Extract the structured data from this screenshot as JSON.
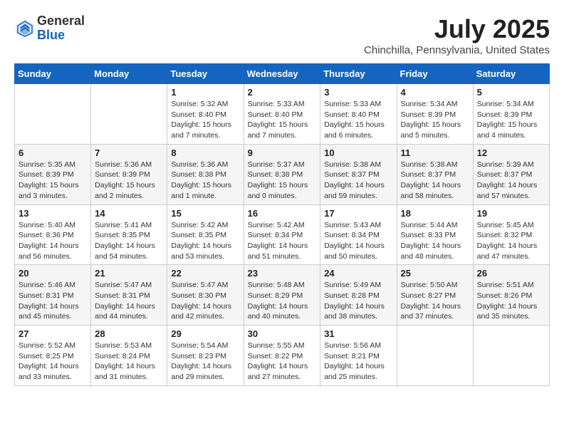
{
  "header": {
    "logo_general": "General",
    "logo_blue": "Blue",
    "month_title": "July 2025",
    "location": "Chinchilla, Pennsylvania, United States"
  },
  "weekdays": [
    "Sunday",
    "Monday",
    "Tuesday",
    "Wednesday",
    "Thursday",
    "Friday",
    "Saturday"
  ],
  "weeks": [
    [
      {
        "day": "",
        "info": ""
      },
      {
        "day": "",
        "info": ""
      },
      {
        "day": "1",
        "info": "Sunrise: 5:32 AM\nSunset: 8:40 PM\nDaylight: 15 hours and 7 minutes."
      },
      {
        "day": "2",
        "info": "Sunrise: 5:33 AM\nSunset: 8:40 PM\nDaylight: 15 hours and 7 minutes."
      },
      {
        "day": "3",
        "info": "Sunrise: 5:33 AM\nSunset: 8:40 PM\nDaylight: 15 hours and 6 minutes."
      },
      {
        "day": "4",
        "info": "Sunrise: 5:34 AM\nSunset: 8:39 PM\nDaylight: 15 hours and 5 minutes."
      },
      {
        "day": "5",
        "info": "Sunrise: 5:34 AM\nSunset: 8:39 PM\nDaylight: 15 hours and 4 minutes."
      }
    ],
    [
      {
        "day": "6",
        "info": "Sunrise: 5:35 AM\nSunset: 8:39 PM\nDaylight: 15 hours and 3 minutes."
      },
      {
        "day": "7",
        "info": "Sunrise: 5:36 AM\nSunset: 8:39 PM\nDaylight: 15 hours and 2 minutes."
      },
      {
        "day": "8",
        "info": "Sunrise: 5:36 AM\nSunset: 8:38 PM\nDaylight: 15 hours and 1 minute."
      },
      {
        "day": "9",
        "info": "Sunrise: 5:37 AM\nSunset: 8:38 PM\nDaylight: 15 hours and 0 minutes."
      },
      {
        "day": "10",
        "info": "Sunrise: 5:38 AM\nSunset: 8:37 PM\nDaylight: 14 hours and 59 minutes."
      },
      {
        "day": "11",
        "info": "Sunrise: 5:38 AM\nSunset: 8:37 PM\nDaylight: 14 hours and 58 minutes."
      },
      {
        "day": "12",
        "info": "Sunrise: 5:39 AM\nSunset: 8:37 PM\nDaylight: 14 hours and 57 minutes."
      }
    ],
    [
      {
        "day": "13",
        "info": "Sunrise: 5:40 AM\nSunset: 8:36 PM\nDaylight: 14 hours and 56 minutes."
      },
      {
        "day": "14",
        "info": "Sunrise: 5:41 AM\nSunset: 8:35 PM\nDaylight: 14 hours and 54 minutes."
      },
      {
        "day": "15",
        "info": "Sunrise: 5:42 AM\nSunset: 8:35 PM\nDaylight: 14 hours and 53 minutes."
      },
      {
        "day": "16",
        "info": "Sunrise: 5:42 AM\nSunset: 8:34 PM\nDaylight: 14 hours and 51 minutes."
      },
      {
        "day": "17",
        "info": "Sunrise: 5:43 AM\nSunset: 8:34 PM\nDaylight: 14 hours and 50 minutes."
      },
      {
        "day": "18",
        "info": "Sunrise: 5:44 AM\nSunset: 8:33 PM\nDaylight: 14 hours and 48 minutes."
      },
      {
        "day": "19",
        "info": "Sunrise: 5:45 AM\nSunset: 8:32 PM\nDaylight: 14 hours and 47 minutes."
      }
    ],
    [
      {
        "day": "20",
        "info": "Sunrise: 5:46 AM\nSunset: 8:31 PM\nDaylight: 14 hours and 45 minutes."
      },
      {
        "day": "21",
        "info": "Sunrise: 5:47 AM\nSunset: 8:31 PM\nDaylight: 14 hours and 44 minutes."
      },
      {
        "day": "22",
        "info": "Sunrise: 5:47 AM\nSunset: 8:30 PM\nDaylight: 14 hours and 42 minutes."
      },
      {
        "day": "23",
        "info": "Sunrise: 5:48 AM\nSunset: 8:29 PM\nDaylight: 14 hours and 40 minutes."
      },
      {
        "day": "24",
        "info": "Sunrise: 5:49 AM\nSunset: 8:28 PM\nDaylight: 14 hours and 38 minutes."
      },
      {
        "day": "25",
        "info": "Sunrise: 5:50 AM\nSunset: 8:27 PM\nDaylight: 14 hours and 37 minutes."
      },
      {
        "day": "26",
        "info": "Sunrise: 5:51 AM\nSunset: 8:26 PM\nDaylight: 14 hours and 35 minutes."
      }
    ],
    [
      {
        "day": "27",
        "info": "Sunrise: 5:52 AM\nSunset: 8:25 PM\nDaylight: 14 hours and 33 minutes."
      },
      {
        "day": "28",
        "info": "Sunrise: 5:53 AM\nSunset: 8:24 PM\nDaylight: 14 hours and 31 minutes."
      },
      {
        "day": "29",
        "info": "Sunrise: 5:54 AM\nSunset: 8:23 PM\nDaylight: 14 hours and 29 minutes."
      },
      {
        "day": "30",
        "info": "Sunrise: 5:55 AM\nSunset: 8:22 PM\nDaylight: 14 hours and 27 minutes."
      },
      {
        "day": "31",
        "info": "Sunrise: 5:56 AM\nSunset: 8:21 PM\nDaylight: 14 hours and 25 minutes."
      },
      {
        "day": "",
        "info": ""
      },
      {
        "day": "",
        "info": ""
      }
    ]
  ]
}
